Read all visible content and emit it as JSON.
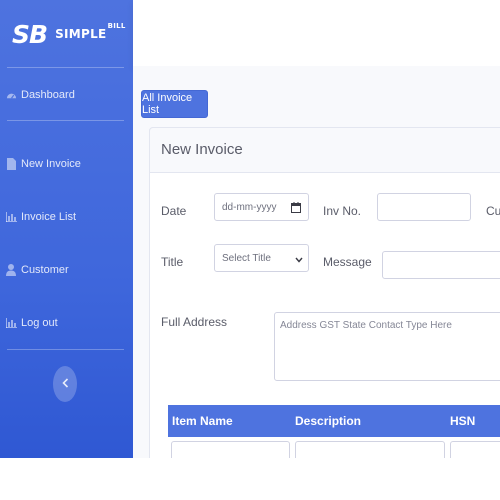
{
  "brand": {
    "logo": "SB",
    "name": "SIMPLE",
    "name_sup": "BILL"
  },
  "sidebar": {
    "items": [
      {
        "label": "Dashboard",
        "icon": "dashboard-icon"
      },
      {
        "label": "New Invoice",
        "icon": "file-icon"
      },
      {
        "label": "Invoice List",
        "icon": "bar-chart-icon"
      },
      {
        "label": "Customer",
        "icon": "user-icon"
      },
      {
        "label": "Log out",
        "icon": "bar-chart-icon"
      }
    ],
    "toggle_icon": "chevron-left-icon"
  },
  "toolbar": {
    "all_invoice_list": "All Invoice List"
  },
  "form": {
    "title": "New Invoice",
    "date_label": "Date",
    "date_placeholder": "dd-mm-yyyy",
    "inv_no_label": "Inv No.",
    "inv_no_value": "",
    "cust_label": "Cus",
    "title_label": "Title",
    "title_select": "Select Title",
    "message_label": "Message",
    "message_value": "",
    "full_address_label": "Full Address",
    "address_placeholder": "Address GST State Contact Type Here"
  },
  "table": {
    "columns": [
      "Item Name",
      "Description",
      "HSN"
    ]
  },
  "colors": {
    "primary": "#4e73df",
    "text": "#5a5c69",
    "border": "#d1d3e2"
  }
}
